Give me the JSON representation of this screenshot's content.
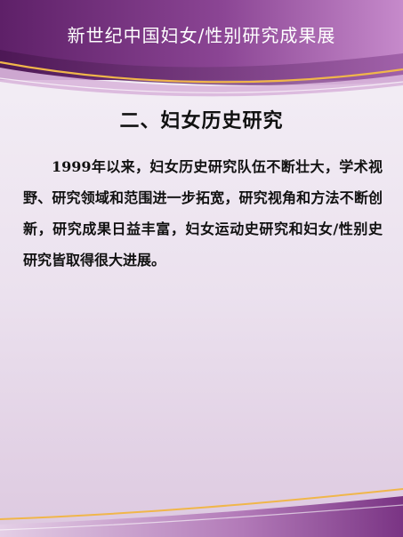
{
  "banner": {
    "title": "新世纪中国妇女/性别研究成果展"
  },
  "section": {
    "title": "二、妇女历史研究"
  },
  "content": {
    "paragraph": "1999年以来，妇女历史研究队伍不断壮大，学术视野、研究领域和范围进一步拓宽，研究视角和方法不断创新，研究成果日益丰富，妇女运动史研究和妇女/性别史研究皆取得很大进展。"
  },
  "colors": {
    "banner_dark": "#5b1f66",
    "banner_mid": "#8a3f92",
    "banner_light": "#c487c8",
    "accent_gold": "#f0b64a",
    "page_background": "#efe7f1"
  }
}
